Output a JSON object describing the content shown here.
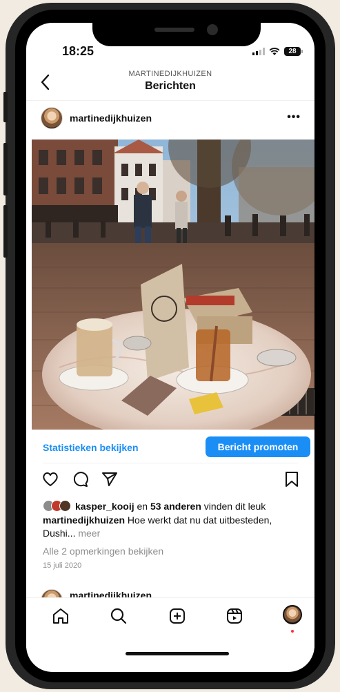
{
  "status_bar": {
    "time": "18:25",
    "battery": "28"
  },
  "header": {
    "subtitle": "MARTINEDIJKHUIZEN",
    "title": "Berichten"
  },
  "post": {
    "username": "martinedijkhuizen",
    "more_label": "•••",
    "stats_link": "Statistieken bekijken",
    "promote_button": "Bericht promoten",
    "likes": {
      "user": "kasper_kooij",
      "and": " en ",
      "others": "53 anderen",
      "suffix": " vinden dit leuk"
    },
    "caption": {
      "username": "martinedijkhuizen",
      "text": " Hoe werkt dat nu dat uitbesteden, Dushi...",
      "more": " meer"
    },
    "view_comments": "Alle 2 opmerkingen bekijken",
    "date": "15 juli 2020"
  },
  "next_post": {
    "username": "martinedijkhuizen"
  },
  "colors": {
    "accent": "#1a8ef5",
    "notification_dot": "#ff3040"
  },
  "icons": [
    "back-chevron-icon",
    "more-dots-icon",
    "heart-icon",
    "comment-icon",
    "share-icon",
    "bookmark-icon",
    "home-icon",
    "search-icon",
    "create-icon",
    "reels-icon",
    "profile-icon"
  ]
}
